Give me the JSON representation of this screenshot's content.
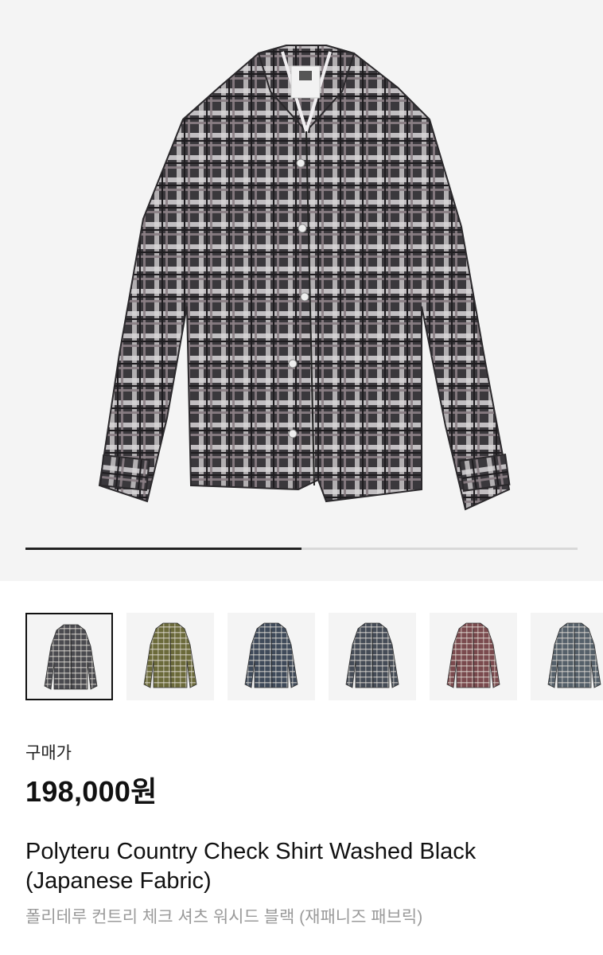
{
  "hero": {
    "image_name": "plaid-shirt-washed-black",
    "carousel_progress": 0.5
  },
  "thumbnails": [
    {
      "name": "washed-black",
      "color": "#4a4a4f",
      "selected": true
    },
    {
      "name": "olive",
      "color": "#6b6a3a",
      "selected": false
    },
    {
      "name": "navy",
      "color": "#3f4a5a",
      "selected": false
    },
    {
      "name": "slate",
      "color": "#454c57",
      "selected": false
    },
    {
      "name": "burgundy",
      "color": "#7a4a4e",
      "selected": false
    },
    {
      "name": "grey-blue",
      "color": "#55606a",
      "selected": false
    }
  ],
  "price": {
    "label": "구매가",
    "value": "198,000원"
  },
  "product": {
    "title_en": "Polyteru Country Check Shirt Washed Black (Japanese Fabric)",
    "title_ko": "폴리테루 컨트리 체크 셔츠 워시드 블랙 (재패니즈 패브릭)"
  }
}
